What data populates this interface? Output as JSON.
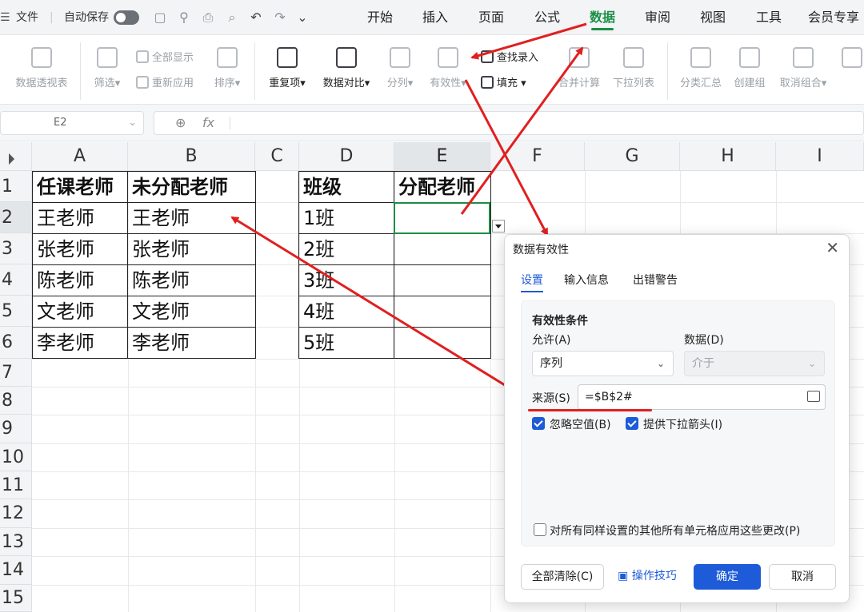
{
  "topbar": {
    "file_label": "文件",
    "autosave_label": "自动保存",
    "tabs": [
      "开始",
      "插入",
      "页面",
      "公式",
      "数据",
      "审阅",
      "视图",
      "工具",
      "会员专享"
    ],
    "active_tab": "数据"
  },
  "ribbon": {
    "pivot": "数据透视表",
    "filter": "筛选",
    "show_all": "全部显示",
    "reapply": "重新应用",
    "sort": "排序",
    "duplicates": "重复项",
    "compare": "数据对比",
    "split": "分列",
    "validity": "有效性",
    "lookup_entry": "查找录入",
    "fill": "填充",
    "consolidate": "合并计算",
    "dropdown_list": "下拉列表",
    "subtotal": "分类汇总",
    "group": "创建组",
    "ungroup": "取消组合"
  },
  "formula_bar": {
    "name_box": "E2",
    "fx": "fx",
    "formula": ""
  },
  "sheet": {
    "columns": [
      "A",
      "B",
      "C",
      "D",
      "E",
      "F",
      "G",
      "H",
      "I"
    ],
    "rows": [
      "1",
      "2",
      "3",
      "4",
      "5",
      "6",
      "7",
      "8",
      "9",
      "10",
      "11",
      "12",
      "13",
      "14",
      "15"
    ],
    "selected_cell": "E2",
    "table1": {
      "headers": [
        "任课老师",
        "未分配老师"
      ],
      "rows": [
        [
          "王老师",
          "王老师"
        ],
        [
          "张老师",
          "张老师"
        ],
        [
          "陈老师",
          "陈老师"
        ],
        [
          "文老师",
          "文老师"
        ],
        [
          "李老师",
          "李老师"
        ]
      ]
    },
    "table2": {
      "headers": [
        "班级",
        "分配老师"
      ],
      "rows": [
        [
          "1班",
          ""
        ],
        [
          "2班",
          ""
        ],
        [
          "3班",
          ""
        ],
        [
          "4班",
          ""
        ],
        [
          "5班",
          ""
        ]
      ]
    }
  },
  "dialog": {
    "title": "数据有效性",
    "tabs": [
      "设置",
      "输入信息",
      "出错警告"
    ],
    "section_title": "有效性条件",
    "allow_label": "允许(A)",
    "allow_value": "序列",
    "data_label": "数据(D)",
    "data_value": "介于",
    "source_label": "来源(S)",
    "source_value": "=$B$2#",
    "ignore_blank": "忽略空值(B)",
    "dropdown_arrow": "提供下拉箭头(I)",
    "apply_all": "对所有同样设置的其他所有单元格应用这些更改(P)",
    "clear_all": "全部清除(C)",
    "tips": "操作技巧",
    "ok": "确定",
    "cancel": "取消"
  },
  "annotation_color": "#e02020"
}
